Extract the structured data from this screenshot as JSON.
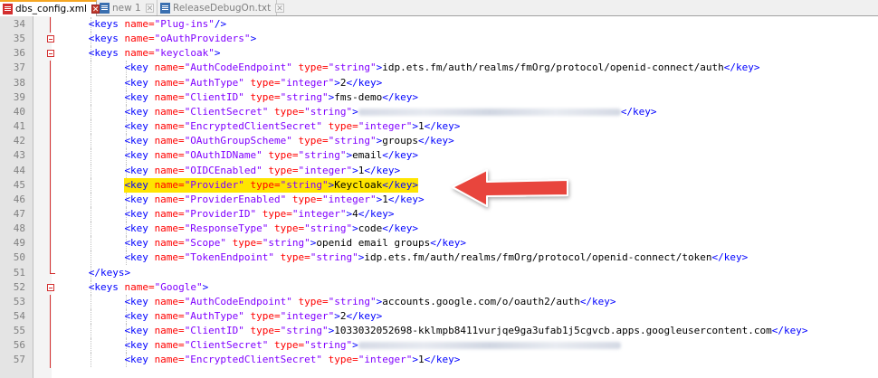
{
  "tabs": [
    {
      "label": "dbs_config.xml",
      "active": true,
      "icon": "xml-file-icon"
    },
    {
      "label": "new 1",
      "active": false,
      "icon": "text-file-icon"
    },
    {
      "label": "ReleaseDebugOn.txt",
      "active": false,
      "icon": "text-file-icon"
    }
  ],
  "colors": {
    "tag": "#0000ff",
    "attribute": "#ff0000",
    "value": "#8000ff",
    "highlight": "#ffe500",
    "arrow": "#e8453c"
  },
  "editor": {
    "highlighted_line": 45,
    "lines": [
      {
        "n": "34",
        "indent": 2,
        "fold": "none",
        "parts": [
          [
            "tag",
            "<keys "
          ],
          [
            "attr",
            "name="
          ],
          [
            "val",
            "\"Plug-ins\""
          ],
          [
            "tag",
            "/>"
          ]
        ]
      },
      {
        "n": "35",
        "indent": 2,
        "fold": "open",
        "parts": [
          [
            "tag",
            "<keys "
          ],
          [
            "attr",
            "name="
          ],
          [
            "val",
            "\"oAuthProviders\""
          ],
          [
            "tag",
            ">"
          ]
        ]
      },
      {
        "n": "36",
        "indent": 2,
        "fold": "open",
        "parts": [
          [
            "tag",
            "<keys "
          ],
          [
            "attr",
            "name="
          ],
          [
            "val",
            "\"keycloak\""
          ],
          [
            "tag",
            ">"
          ]
        ]
      },
      {
        "n": "37",
        "indent": 3,
        "fold": "none",
        "parts": [
          [
            "tag",
            "<key "
          ],
          [
            "attr",
            "name="
          ],
          [
            "val",
            "\"AuthCodeEndpoint\""
          ],
          [
            "attr",
            " type="
          ],
          [
            "val",
            "\"string\""
          ],
          [
            "tag",
            ">"
          ],
          [
            "txt",
            "idp.ets.fm/auth/realms/fmOrg/protocol/openid-connect/auth"
          ],
          [
            "tag",
            "</key>"
          ]
        ]
      },
      {
        "n": "38",
        "indent": 3,
        "fold": "none",
        "parts": [
          [
            "tag",
            "<key "
          ],
          [
            "attr",
            "name="
          ],
          [
            "val",
            "\"AuthType\""
          ],
          [
            "attr",
            " type="
          ],
          [
            "val",
            "\"integer\""
          ],
          [
            "tag",
            ">"
          ],
          [
            "txt",
            "2"
          ],
          [
            "tag",
            "</key>"
          ]
        ]
      },
      {
        "n": "39",
        "indent": 3,
        "fold": "none",
        "parts": [
          [
            "tag",
            "<key "
          ],
          [
            "attr",
            "name="
          ],
          [
            "val",
            "\"ClientID\""
          ],
          [
            "attr",
            " type="
          ],
          [
            "val",
            "\"string\""
          ],
          [
            "tag",
            ">"
          ],
          [
            "txt",
            "fms-demo"
          ],
          [
            "tag",
            "</key>"
          ]
        ]
      },
      {
        "n": "40",
        "indent": 3,
        "fold": "none",
        "parts": [
          [
            "tag",
            "<key "
          ],
          [
            "attr",
            "name="
          ],
          [
            "val",
            "\"ClientSecret\""
          ],
          [
            "attr",
            " type="
          ],
          [
            "val",
            "\"string\""
          ],
          [
            "tag",
            ">"
          ],
          [
            "blur",
            "redacted"
          ],
          [
            "tag",
            "</key>"
          ]
        ]
      },
      {
        "n": "41",
        "indent": 3,
        "fold": "none",
        "parts": [
          [
            "tag",
            "<key "
          ],
          [
            "attr",
            "name="
          ],
          [
            "val",
            "\"EncryptedClientSecret\""
          ],
          [
            "attr",
            " type="
          ],
          [
            "val",
            "\"integer\""
          ],
          [
            "tag",
            ">"
          ],
          [
            "txt",
            "1"
          ],
          [
            "tag",
            "</key>"
          ]
        ]
      },
      {
        "n": "42",
        "indent": 3,
        "fold": "none",
        "parts": [
          [
            "tag",
            "<key "
          ],
          [
            "attr",
            "name="
          ],
          [
            "val",
            "\"OAuthGroupScheme\""
          ],
          [
            "attr",
            " type="
          ],
          [
            "val",
            "\"string\""
          ],
          [
            "tag",
            ">"
          ],
          [
            "txt",
            "groups"
          ],
          [
            "tag",
            "</key>"
          ]
        ]
      },
      {
        "n": "43",
        "indent": 3,
        "fold": "none",
        "parts": [
          [
            "tag",
            "<key "
          ],
          [
            "attr",
            "name="
          ],
          [
            "val",
            "\"OAuthIDName\""
          ],
          [
            "attr",
            " type="
          ],
          [
            "val",
            "\"string\""
          ],
          [
            "tag",
            ">"
          ],
          [
            "txt",
            "email"
          ],
          [
            "tag",
            "</key>"
          ]
        ]
      },
      {
        "n": "44",
        "indent": 3,
        "fold": "none",
        "parts": [
          [
            "tag",
            "<key "
          ],
          [
            "attr",
            "name="
          ],
          [
            "val",
            "\"OIDCEnabled\""
          ],
          [
            "attr",
            " type="
          ],
          [
            "val",
            "\"integer\""
          ],
          [
            "tag",
            ">"
          ],
          [
            "txt",
            "1"
          ],
          [
            "tag",
            "</key>"
          ]
        ]
      },
      {
        "n": "45",
        "indent": 3,
        "fold": "none",
        "parts": [
          [
            "tag",
            "<key "
          ],
          [
            "attr",
            "name="
          ],
          [
            "val",
            "\"Provider\""
          ],
          [
            "attr",
            " type="
          ],
          [
            "val",
            "\"string\""
          ],
          [
            "tag",
            ">"
          ],
          [
            "txt",
            "Keycloak"
          ],
          [
            "tag",
            "</key>"
          ]
        ]
      },
      {
        "n": "46",
        "indent": 3,
        "fold": "none",
        "parts": [
          [
            "tag",
            "<key "
          ],
          [
            "attr",
            "name="
          ],
          [
            "val",
            "\"ProviderEnabled\""
          ],
          [
            "attr",
            " type="
          ],
          [
            "val",
            "\"integer\""
          ],
          [
            "tag",
            ">"
          ],
          [
            "txt",
            "1"
          ],
          [
            "tag",
            "</key>"
          ]
        ]
      },
      {
        "n": "47",
        "indent": 3,
        "fold": "none",
        "parts": [
          [
            "tag",
            "<key "
          ],
          [
            "attr",
            "name="
          ],
          [
            "val",
            "\"ProviderID\""
          ],
          [
            "attr",
            " type="
          ],
          [
            "val",
            "\"integer\""
          ],
          [
            "tag",
            ">"
          ],
          [
            "txt",
            "4"
          ],
          [
            "tag",
            "</key>"
          ]
        ]
      },
      {
        "n": "48",
        "indent": 3,
        "fold": "none",
        "parts": [
          [
            "tag",
            "<key "
          ],
          [
            "attr",
            "name="
          ],
          [
            "val",
            "\"ResponseType\""
          ],
          [
            "attr",
            " type="
          ],
          [
            "val",
            "\"string\""
          ],
          [
            "tag",
            ">"
          ],
          [
            "txt",
            "code"
          ],
          [
            "tag",
            "</key>"
          ]
        ]
      },
      {
        "n": "49",
        "indent": 3,
        "fold": "none",
        "parts": [
          [
            "tag",
            "<key "
          ],
          [
            "attr",
            "name="
          ],
          [
            "val",
            "\"Scope\""
          ],
          [
            "attr",
            " type="
          ],
          [
            "val",
            "\"string\""
          ],
          [
            "tag",
            ">"
          ],
          [
            "txt",
            "openid email groups"
          ],
          [
            "tag",
            "</key>"
          ]
        ]
      },
      {
        "n": "50",
        "indent": 3,
        "fold": "none",
        "parts": [
          [
            "tag",
            "<key "
          ],
          [
            "attr",
            "name="
          ],
          [
            "val",
            "\"TokenEndpoint\""
          ],
          [
            "attr",
            " type="
          ],
          [
            "val",
            "\"string\""
          ],
          [
            "tag",
            ">"
          ],
          [
            "txt",
            "idp.ets.fm/auth/realms/fmOrg/protocol/openid-connect/token"
          ],
          [
            "tag",
            "</key>"
          ]
        ]
      },
      {
        "n": "51",
        "indent": 2,
        "fold": "end",
        "parts": [
          [
            "tag",
            "</keys>"
          ]
        ]
      },
      {
        "n": "52",
        "indent": 2,
        "fold": "open",
        "parts": [
          [
            "tag",
            "<keys "
          ],
          [
            "attr",
            "name="
          ],
          [
            "val",
            "\"Google\""
          ],
          [
            "tag",
            ">"
          ]
        ]
      },
      {
        "n": "53",
        "indent": 3,
        "fold": "none",
        "parts": [
          [
            "tag",
            "<key "
          ],
          [
            "attr",
            "name="
          ],
          [
            "val",
            "\"AuthCodeEndpoint\""
          ],
          [
            "attr",
            " type="
          ],
          [
            "val",
            "\"string\""
          ],
          [
            "tag",
            ">"
          ],
          [
            "txt",
            "accounts.google.com/o/oauth2/auth"
          ],
          [
            "tag",
            "</key>"
          ]
        ]
      },
      {
        "n": "54",
        "indent": 3,
        "fold": "none",
        "parts": [
          [
            "tag",
            "<key "
          ],
          [
            "attr",
            "name="
          ],
          [
            "val",
            "\"AuthType\""
          ],
          [
            "attr",
            " type="
          ],
          [
            "val",
            "\"integer\""
          ],
          [
            "tag",
            ">"
          ],
          [
            "txt",
            "2"
          ],
          [
            "tag",
            "</key>"
          ]
        ]
      },
      {
        "n": "55",
        "indent": 3,
        "fold": "none",
        "parts": [
          [
            "tag",
            "<key "
          ],
          [
            "attr",
            "name="
          ],
          [
            "val",
            "\"ClientID\""
          ],
          [
            "attr",
            " type="
          ],
          [
            "val",
            "\"string\""
          ],
          [
            "tag",
            ">"
          ],
          [
            "txt",
            "1033032052698-kklmpb8411vurjqe9ga3ufab1j5cgvcb.apps.googleusercontent.com"
          ],
          [
            "tag",
            "</key>"
          ]
        ]
      },
      {
        "n": "56",
        "indent": 3,
        "fold": "none",
        "parts": [
          [
            "tag",
            "<key "
          ],
          [
            "attr",
            "name="
          ],
          [
            "val",
            "\"ClientSecret\""
          ],
          [
            "attr",
            " type="
          ],
          [
            "val",
            "\"string\""
          ],
          [
            "tag",
            ">"
          ],
          [
            "blur",
            "redacted"
          ]
        ]
      },
      {
        "n": "57",
        "indent": 3,
        "fold": "none",
        "parts": [
          [
            "tag",
            "<key "
          ],
          [
            "attr",
            "name="
          ],
          [
            "val",
            "\"EncryptedClientSecret\""
          ],
          [
            "attr",
            " type="
          ],
          [
            "val",
            "\"integer\""
          ],
          [
            "tag",
            ">"
          ],
          [
            "txt",
            "1"
          ],
          [
            "tag",
            "</key>"
          ]
        ]
      }
    ]
  }
}
